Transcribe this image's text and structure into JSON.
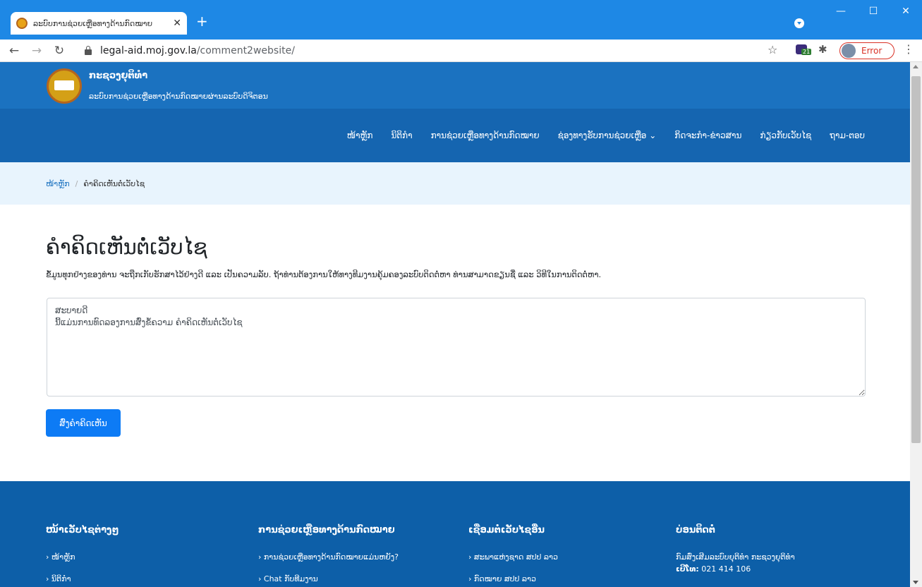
{
  "browser": {
    "tab_title": "ລະບົບການຊ່ວຍເຫຼືອທາງດ້ານກົດໝາຍ",
    "new_tab": "+",
    "tab_close": "✕",
    "url_host": "legal-aid.moj.gov.la",
    "url_path": "/comment2website/",
    "ext_badge": "21",
    "error_label": "Error",
    "win_min": "—",
    "win_max": "☐",
    "win_close": "✕"
  },
  "header": {
    "site_title": "ກະຊວງຍຸຕິທຳ",
    "site_subtitle": "ລະບົບການຊ່ວຍເຫຼືອທາງດ້ານກົດໝາຍຜ່ານລະບົບດິຈິຕອນ"
  },
  "nav": {
    "items": [
      "ໜ້າຫຼັກ",
      "ນິຕິກຳ",
      "ການຊ່ວຍເຫຼືອທາງດ້ານກົດໝາຍ",
      "ຊ່ອງທາງຮັບການຊ່ວຍເຫຼືອ ⌄",
      "ກິດຈະກຳ-ຂ່າວສານ",
      "ກ່ຽວກັບເວັບໄຊ",
      "ຖາມ-ຕອບ"
    ]
  },
  "breadcrumb": {
    "home": "ໜ້າຫຼັກ",
    "separator": "/",
    "current": "ຄຳຄິດເຫັນຕໍ່ເວັບໄຊ"
  },
  "main": {
    "title": "ຄຳຄິດເຫັນຕໍ່ເວັບໄຊ",
    "intro": "ຂໍ້ມູນທຸກຢ່າງຂອງທ່ານ ຈະຖືກເກັບຮັກສາໄວ້ຢ່າງດີ ແລະ ເປັນຄວາມລັບ. ຖ້າທ່ານຕ້ອງການໃຫ້ທາງທີມງານຄຸ້ມຄອງລະບົບຕິດຕໍ່ຫາ ທ່ານສາມາດຂຽນຊື່ ແລະ ວິທີໃນການຕິດຕໍ່ຫາ.",
    "comment_value": "ສະບາຍດີ\nນີ້ແມ່ນການທົດລອງການສົ່ງຂໍ້ຄວາມ ຄຳຄິດເຫັນຕໍ່ເວັບໄຊ",
    "submit_label": "ສົ່ງຄຳຄິດເຫັນ"
  },
  "footer": {
    "col1": {
      "heading": "ໜ້າເວັບໄຊຕ່າງໆ",
      "links": [
        "› ໜ້າຫຼັກ",
        "› ນິຕິກຳ"
      ]
    },
    "col2": {
      "heading": "ການຊ່ວຍເຫຼືອທາງດ້ານກົດໝາຍ",
      "links": [
        "› ການຊ່ວຍເຫຼືອທາງດ້ານກົດໝາຍແມ່ນຫຍັງ?",
        "› Chat ກັບທີມງານ"
      ]
    },
    "col3": {
      "heading": "ເຊື່ອມຕໍ່ເວັບໄຊອື່ນ",
      "links": [
        "› ສະພາແຫ່ງຊາດ ສປປ ລາວ",
        "› ກົດໝາຍ ສປປ ລາວ"
      ]
    },
    "col4": {
      "heading": "ບ່ອນຕິດຕໍ່",
      "org": "ກົມສົ່ງເສີມລະບົບຍຸຕິທຳ ກະຊວງຍຸຕິທຳ",
      "phone_label": "ເບີໂທ:",
      "phone": "021 414 106"
    }
  },
  "colors": {
    "tabbar": "#1e88e5",
    "brand_band": "#1b72c0",
    "nav_band": "#1565b0",
    "crumb_band": "#e8f4fd",
    "submit": "#0d7bf5",
    "footer": "#0d5fa8"
  },
  "icons": [
    "favicon-icon",
    "back-icon",
    "forward-icon",
    "reload-icon",
    "lock-icon",
    "star-icon",
    "extension-icon",
    "puzzle-icon",
    "menu-icon",
    "profile-icon"
  ]
}
